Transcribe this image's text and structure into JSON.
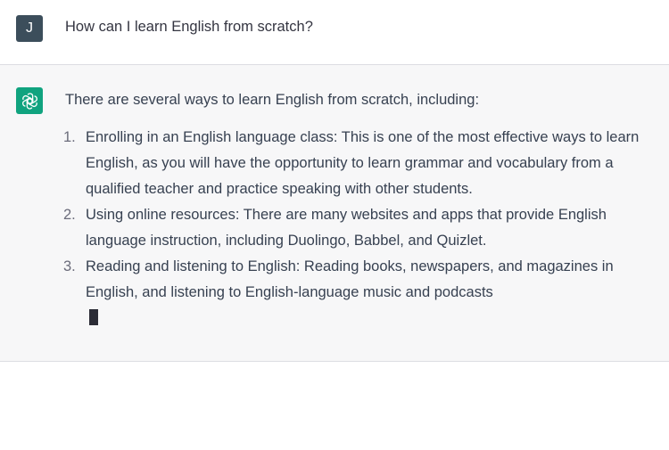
{
  "user_turn": {
    "avatar_initial": "J",
    "avatar_color": "#3c4e5b",
    "message": "How can I learn English from scratch?"
  },
  "assistant_turn": {
    "avatar_icon": "openai-logo-icon",
    "avatar_color": "#10a37f",
    "intro": "There are several ways to learn English from scratch, including:",
    "items": [
      {
        "number": "1.",
        "text": "Enrolling in an English language class: This is one of the most effective ways to learn English, as you will have the opportunity to learn grammar and vocabulary from a qualified teacher and practice speaking with other students."
      },
      {
        "number": "2.",
        "text": "Using online resources: There are many websites and apps that provide English language instruction, including Duolingo, Babbel, and Quizlet."
      },
      {
        "number": "3.",
        "text": "Reading and listening to English: Reading books, newspapers, and magazines in English, and listening to English-language music and podcasts"
      }
    ],
    "streaming_cursor": true
  }
}
